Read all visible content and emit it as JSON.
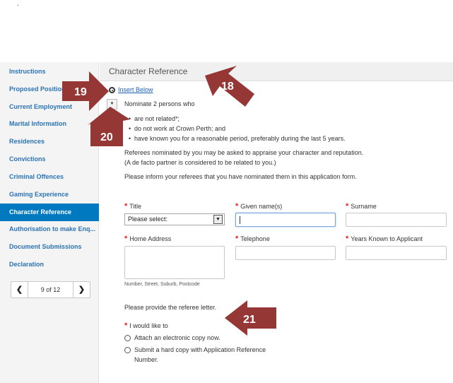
{
  "corner_mark": ".",
  "sidebar": {
    "items": [
      {
        "label": "Instructions",
        "active": false
      },
      {
        "label": "Proposed Position",
        "active": false
      },
      {
        "label": "Current Employment",
        "active": false
      },
      {
        "label": "Marital Information",
        "active": false
      },
      {
        "label": "Residences",
        "active": false
      },
      {
        "label": "Convictions",
        "active": false
      },
      {
        "label": "Criminal Offences",
        "active": false
      },
      {
        "label": "Gaming Experience",
        "active": false
      },
      {
        "label": "Character Reference",
        "active": true
      },
      {
        "label": "Authorisation to make Enq...",
        "active": false
      },
      {
        "label": "Document Submissions",
        "active": false
      },
      {
        "label": "Declaration",
        "active": false
      }
    ],
    "pager": {
      "prev_icon": "❮",
      "count": "9 of 12",
      "next_icon": "❯"
    }
  },
  "header": {
    "title": "Character Reference"
  },
  "content": {
    "insert_below": "Insert Below",
    "collapse_icon": "▼",
    "nominate": "Nominate 2 persons who",
    "bullets": [
      "are not related*;",
      "do not work at Crown Perth; and",
      "have known you for a reasonable period, preferably during the last 5 years."
    ],
    "appraise": "Referees nominated by you may be asked to appraise your character and reputation.",
    "defacto": "(A de facto partner is considered to be related to you.)",
    "inform": "Please inform your referees that you have nominated them in this application form.",
    "required_mark": "*"
  },
  "form": {
    "title_label": "Title",
    "title_value": "Please select:",
    "select_arrow": "▼",
    "given_label": "Given name(s)",
    "given_value": "",
    "surname_label": "Surname",
    "surname_value": "",
    "home_label": "Home Address",
    "home_hint": "Number, Street, Suburb, Postcode",
    "telephone_label": "Telephone",
    "years_label": "Years Known to Applicant",
    "letter_prompt": "Please provide the referee letter.",
    "like_label": "I would like to",
    "option1": "Attach an electronic copy now.",
    "option2_line1": "Submit a hard copy with Application Reference",
    "option2_line2": "Number."
  },
  "annotations": {
    "a18": "18",
    "a19": "19",
    "a20": "20",
    "a21": "21"
  },
  "colors": {
    "arrow": "#953735",
    "accent": "#0079c1",
    "link": "#2a73b8",
    "required": "#d9261c"
  }
}
